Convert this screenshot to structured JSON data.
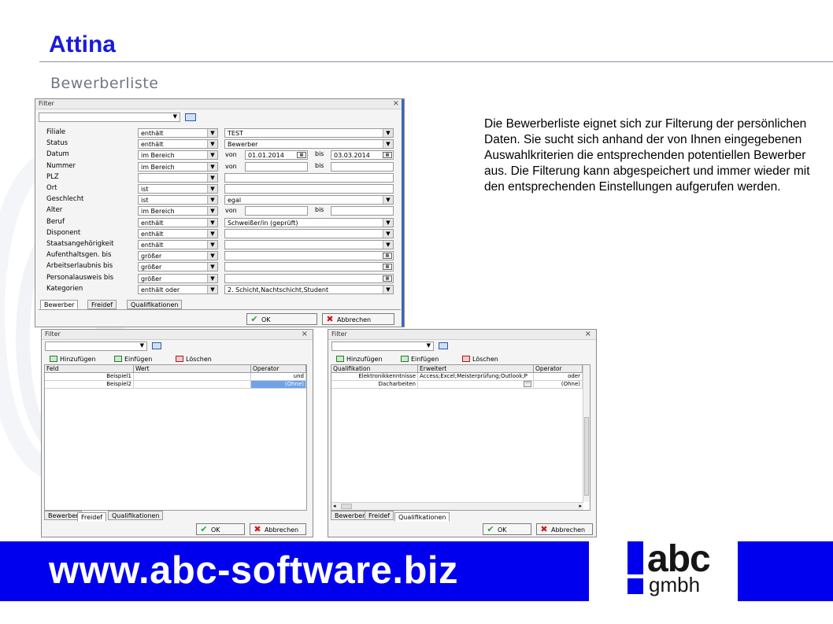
{
  "header": {
    "title": "Attina",
    "subtitle": "Bewerberliste"
  },
  "description": "Die Bewerberliste eignet sich zur Filterung der persönlichen Daten. Sie sucht sich anhand der von Ihnen eingegebenen Auswahlkriterien die entsprechenden potentiellen Bewerber aus. Die Filterung kann abgespeichert und immer wieder mit den entsprechenden Einstellungen aufgerufen werden.",
  "main_dialog": {
    "title": "Filter",
    "close": "×",
    "von": "von",
    "bis": "bis",
    "rows": [
      {
        "label": "Filiale",
        "op": "enthält",
        "value": "TEST"
      },
      {
        "label": "Status",
        "op": "enthält",
        "value": "Bewerber"
      },
      {
        "label": "Datum",
        "op": "im Bereich",
        "from": "01.01.2014",
        "to": "03.03.2014"
      },
      {
        "label": "Nummer",
        "op": "im Bereich",
        "from": "",
        "to": ""
      },
      {
        "label": "PLZ",
        "op": "",
        "value": ""
      },
      {
        "label": "Ort",
        "op": "ist",
        "value": ""
      },
      {
        "label": "Geschlecht",
        "op": "ist",
        "value": "egal"
      },
      {
        "label": "Alter",
        "op": "im Bereich",
        "from": "",
        "to": ""
      },
      {
        "label": "Beruf",
        "op": "enthält",
        "value": "Schweißer/in (geprüft)"
      },
      {
        "label": "Disponent",
        "op": "enthält",
        "value": ""
      },
      {
        "label": "Staatsangehörigkeit",
        "op": "enthält",
        "value": ""
      },
      {
        "label": "Aufenthaltsgen. bis",
        "op": "größer",
        "value": ""
      },
      {
        "label": "Arbeitserlaubnis bis",
        "op": "größer",
        "value": ""
      },
      {
        "label": "Personalausweis bis",
        "op": "größer",
        "value": ""
      },
      {
        "label": "Kategorien",
        "op": "enthält oder",
        "value": "2. Schicht,Nachtschicht,Student"
      }
    ],
    "tabs": [
      "Bewerber",
      "Freidef",
      "Qualifikationen"
    ],
    "ok": "OK",
    "cancel": "Abbrechen"
  },
  "freidef_dialog": {
    "title": "Filter",
    "close": "×",
    "toolbar": [
      "Hinzufügen",
      "Einfügen",
      "Löschen"
    ],
    "columns": [
      "Feld",
      "Wert",
      "Operator"
    ],
    "rows": [
      [
        "Beispiel1",
        "",
        "und"
      ],
      [
        "Beispiel2",
        "",
        "(Ohne)"
      ]
    ],
    "tabs": [
      "Bewerber",
      "Freidef",
      "Qualifikationen"
    ],
    "ok": "OK",
    "cancel": "Abbrechen"
  },
  "quali_dialog": {
    "title": "Filter",
    "close": "×",
    "toolbar": [
      "Hinzufügen",
      "Einfügen",
      "Löschen"
    ],
    "columns": [
      "Qualifikation",
      "Erweitert",
      "Operator"
    ],
    "rows": [
      [
        "Elektronikkenntnisse",
        "Access;Excel;Meisterprüfung;Outlook;P",
        "oder"
      ],
      [
        "Dacharbeiten",
        "",
        "(Ohne)"
      ]
    ],
    "tabs": [
      "Bewerber",
      "Freidef",
      "Qualifikationen"
    ],
    "ok": "OK",
    "cancel": "Abbrechen"
  },
  "footer": {
    "url": "www.abc-software.biz",
    "logo_top": "abc",
    "logo_bottom": "gmbh"
  },
  "colors": {
    "title": "#1a1adc",
    "footer_blue": "#0000ee",
    "selection": "#6fa3e8"
  }
}
